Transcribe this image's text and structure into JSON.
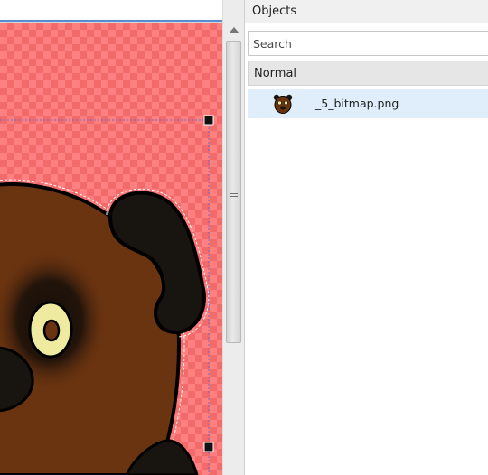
{
  "colors": {
    "checker_light": "#ff8080",
    "checker_dark": "#f36a6a",
    "bear_fur": "#6b3410",
    "bear_dark": "#181410",
    "eye_ring": "#eeeaa0",
    "selection_row": "#e0edfb",
    "handle": "#111111"
  },
  "canvas": {
    "content": "bitmap-bear-face",
    "selection_handles": [
      "top-right",
      "bottom-right"
    ]
  },
  "scrollbar": {
    "thumb_position_fraction": 0.0,
    "thumb_size_fraction": 0.68
  },
  "objects_panel": {
    "title": "Objects",
    "search": {
      "placeholder": "Search",
      "value": ""
    },
    "groups": [
      {
        "label": "Normal",
        "items": [
          {
            "name": "_5_bitmap.png",
            "icon": "bear-thumbnail-icon",
            "selected": true
          }
        ]
      }
    ]
  }
}
